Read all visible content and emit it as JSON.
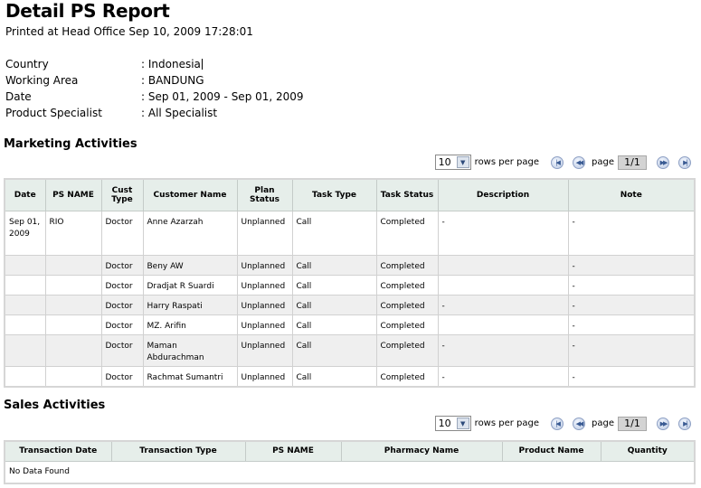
{
  "header": {
    "title": "Detail PS Report",
    "printed": "Printed at Head Office Sep 10, 2009 17:28:01"
  },
  "meta": [
    {
      "label": "Country",
      "value": "Indonesia"
    },
    {
      "label": "Working Area",
      "value": "BANDUNG"
    },
    {
      "label": "Date",
      "value": "Sep 01, 2009 - Sep 01, 2009"
    },
    {
      "label": "Product Specialist",
      "value": "All Specialist"
    }
  ],
  "marketing": {
    "title": "Marketing Activities",
    "pager": {
      "rows": "10",
      "rows_label": "rows per page",
      "page_label": "page",
      "page": "1/1"
    },
    "columns": [
      "Date",
      "PS NAME",
      "Cust Type",
      "Customer Name",
      "Plan Status",
      "Task Type",
      "Task Status",
      "Description",
      "Note"
    ],
    "rows": [
      {
        "date": "Sep 01, 2009",
        "ps": "RIO",
        "cust": "Doctor",
        "name": "Anne Azarzah",
        "plan": "Unplanned",
        "task": "Call",
        "status": "Completed",
        "desc": "-",
        "note": "-"
      },
      {
        "date": "",
        "ps": "",
        "cust": "Doctor",
        "name": "Beny AW",
        "plan": "Unplanned",
        "task": "Call",
        "status": "Completed",
        "desc": "",
        "note": "-"
      },
      {
        "date": "",
        "ps": "",
        "cust": "Doctor",
        "name": "Dradjat R Suardi",
        "plan": "Unplanned",
        "task": "Call",
        "status": "Completed",
        "desc": "",
        "note": "-"
      },
      {
        "date": "",
        "ps": "",
        "cust": "Doctor",
        "name": "Harry Raspati",
        "plan": "Unplanned",
        "task": "Call",
        "status": "Completed",
        "desc": "-",
        "note": "-"
      },
      {
        "date": "",
        "ps": "",
        "cust": "Doctor",
        "name": "MZ. Arifin",
        "plan": "Unplanned",
        "task": "Call",
        "status": "Completed",
        "desc": "",
        "note": "-"
      },
      {
        "date": "",
        "ps": "",
        "cust": "Doctor",
        "name": "Maman Abdurachman",
        "plan": "Unplanned",
        "task": "Call",
        "status": "Completed",
        "desc": "-",
        "note": "-"
      },
      {
        "date": "",
        "ps": "",
        "cust": "Doctor",
        "name": "Rachmat Sumantri",
        "plan": "Unplanned",
        "task": "Call",
        "status": "Completed",
        "desc": "-",
        "note": "-"
      }
    ]
  },
  "sales": {
    "title": "Sales Activities",
    "pager": {
      "rows": "10",
      "rows_label": "rows per page",
      "page_label": "page",
      "page": "1/1"
    },
    "columns": [
      "Transaction Date",
      "Transaction Type",
      "PS NAME",
      "Pharmacy Name",
      "Product Name",
      "Quantity"
    ],
    "empty": "No Data Found"
  }
}
